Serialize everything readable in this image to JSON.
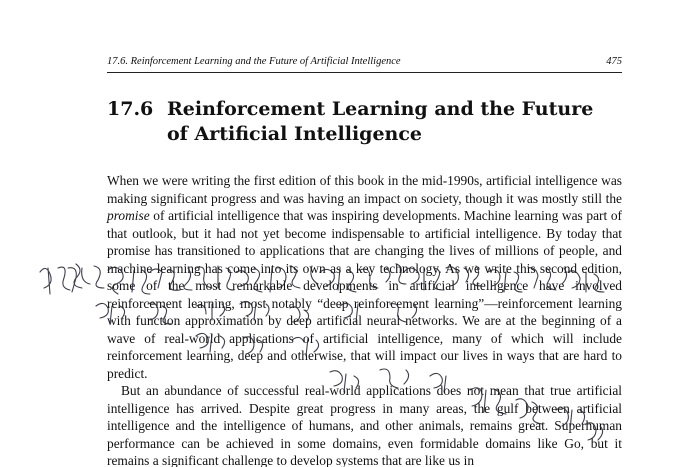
{
  "header": {
    "running_title": "17.6.  Reinforcement Learning and the Future of Artificial Intelligence",
    "page_number": "475"
  },
  "section": {
    "number": "17.6",
    "title": "Reinforcement Learning and the Future of Artificial Intelligence"
  },
  "paragraph1": {
    "before_emphasis": "When we were writing the first edition of this book in the mid-1990s, artificial intelligence was making significant progress and was having an impact on society, though it was mostly still the ",
    "emphasis": "promise",
    "after_emphasis": " of artificial intelligence that was inspiring developments. Machine learning was part of that outlook, but it had not yet become indispensable to artificial intelligence. By today that promise has transitioned to applications that are changing the lives of millions of people, and machine learning has come into its own as a key technology. As we write this second edition, some of the most remarkable developments in artificial intelligence have involved reinforcement learning, most notably “deep reinforcement learning”—reinforcement learning with function approximation by deep artificial neural networks. We are at the beginning of a wave of real-world applications of artificial intelligence, many of which will include reinforcement learning, deep and otherwise, that will impact our lives in ways that are hard to predict."
  },
  "paragraph2": {
    "text": "But an abundance of successful real-world applications does not mean that true artificial intelligence has arrived. Despite great progress in many areas, the gulf between artificial intelligence and the intelligence of humans, and other animals, remains great. Superhuman performance can be achieved in some domains, even formidable domains like Go, but it remains a significant challenge to develop systems that are like us in"
  },
  "overlay": {
    "ink_color": "#2a2a3a",
    "description_icon": "handwriting-scribble"
  }
}
